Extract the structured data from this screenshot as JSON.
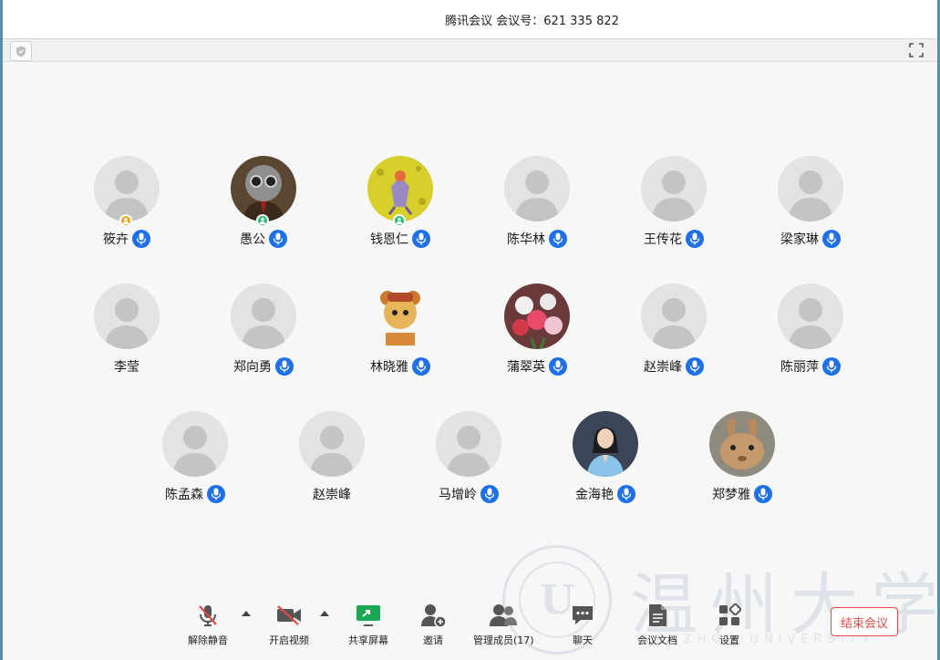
{
  "window": {
    "title": "腾讯会议  会议号：621 335 822"
  },
  "colors": {
    "mic_blue": "#1e6fe8",
    "host_badge": "#f3a21b",
    "cohost_badge": "#1fbf73",
    "end_red": "#e24a4a",
    "screen_share_green": "#1aa856"
  },
  "participants": [
    {
      "name": "筱卉",
      "avatar": "default",
      "badge": "host",
      "mic": true
    },
    {
      "name": "愚公",
      "avatar": "photo-character-glasses",
      "badge": "cohost",
      "mic": true
    },
    {
      "name": "钱恩仁",
      "avatar": "photo-yellow-cartoon",
      "badge": "cohost",
      "mic": true
    },
    {
      "name": "陈华林",
      "avatar": "default",
      "badge": "",
      "mic": true
    },
    {
      "name": "王传花",
      "avatar": "default",
      "badge": "",
      "mic": true
    },
    {
      "name": "梁家琳",
      "avatar": "default",
      "badge": "",
      "mic": true
    },
    {
      "name": "李莹",
      "avatar": "default",
      "badge": "",
      "mic": false
    },
    {
      "name": "郑向勇",
      "avatar": "default",
      "badge": "",
      "mic": true
    },
    {
      "name": "林晓雅",
      "avatar": "photo-bear-cartoon",
      "badge": "",
      "mic": true
    },
    {
      "name": "蒲翠英",
      "avatar": "photo-flowers",
      "badge": "",
      "mic": true
    },
    {
      "name": "赵崇峰",
      "avatar": "default",
      "badge": "",
      "mic": true
    },
    {
      "name": "陈丽萍",
      "avatar": "default",
      "badge": "",
      "mic": true
    },
    {
      "name": "陈孟森",
      "avatar": "default",
      "badge": "",
      "mic": true
    },
    {
      "name": "赵崇峰",
      "avatar": "default",
      "badge": "",
      "mic": false
    },
    {
      "name": "马增岭",
      "avatar": "default",
      "badge": "",
      "mic": true
    },
    {
      "name": "金海艳",
      "avatar": "photo-woman",
      "badge": "",
      "mic": true
    },
    {
      "name": "郑梦雅",
      "avatar": "photo-rabbit",
      "badge": "",
      "mic": true
    }
  ],
  "controls": {
    "unmute": "解除静音",
    "start_video": "开启视频",
    "share_screen": "共享屏幕",
    "invite": "邀请",
    "manage_members": "管理成员(17)",
    "chat": "聊天",
    "meeting_docs": "会议文档",
    "settings": "设置",
    "end_meeting": "结束会议"
  },
  "watermark": {
    "seal_letter": "U",
    "title": "温州大学",
    "subtitle": "WENZHOU UNIVERSITY"
  }
}
